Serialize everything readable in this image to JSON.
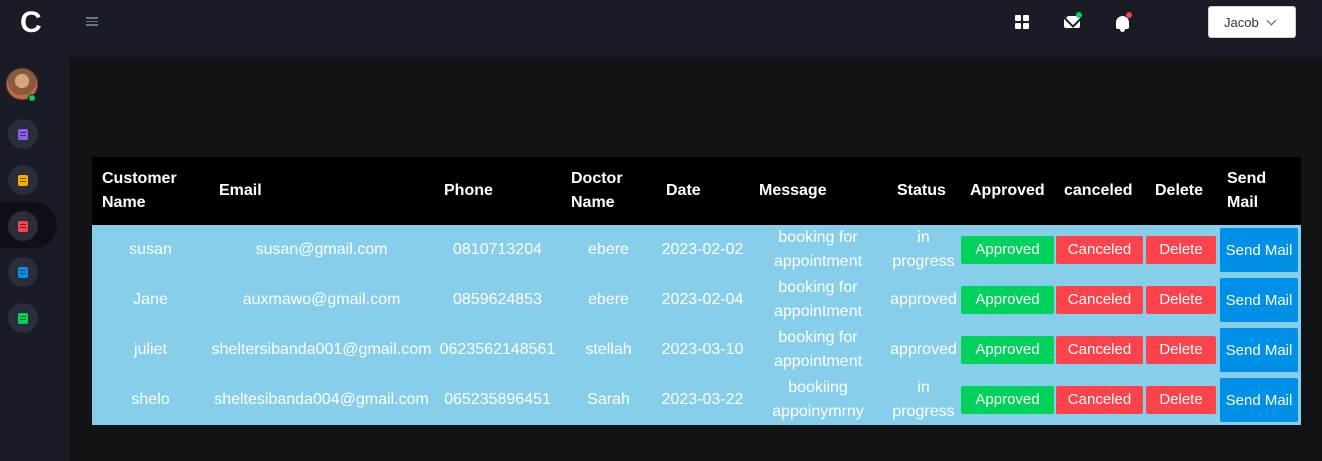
{
  "brand": {
    "logo_letter": "C"
  },
  "sidebar": {
    "items": [
      {
        "icon": "document-icon",
        "color": "#8f5fe8"
      },
      {
        "icon": "document-icon",
        "color": "#ffab00"
      },
      {
        "icon": "document-icon",
        "color": "#fc424a"
      },
      {
        "icon": "document-icon",
        "color": "#0090e7"
      },
      {
        "icon": "document-icon",
        "color": "#00d25b"
      }
    ]
  },
  "topbar": {
    "user_name": "Jacob",
    "mail_badge_color": "#00d25b",
    "bell_badge_color": "#fc424a"
  },
  "table": {
    "headers": [
      "Customer Name",
      "Email",
      "Phone",
      "Doctor Name",
      "Date",
      "Message",
      "Status",
      "Approved",
      "canceled",
      "Delete",
      "Send Mail"
    ],
    "rows": [
      {
        "customer": "susan",
        "email": "susan@gmail.com",
        "phone": "0810713204",
        "doctor": "ebere",
        "date": "2023-02-02",
        "message": "booking for appointment",
        "status": "in progress"
      },
      {
        "customer": "Jane",
        "email": "auxmawo@gmail.com",
        "phone": "0859624853",
        "doctor": "ebere",
        "date": "2023-02-04",
        "message": "booking for appointment",
        "status": "approved"
      },
      {
        "customer": "juliet",
        "email": "sheltersibanda001@gmail.com",
        "phone": "0623562148561",
        "doctor": "stellah",
        "date": "2023-03-10",
        "message": "booking for appointment",
        "status": "approved"
      },
      {
        "customer": "shelo",
        "email": "sheltesibanda004@gmail.com",
        "phone": "065235896451",
        "doctor": "Sarah",
        "date": "2023-03-22",
        "message": "bookiing appoinymrny",
        "status": "in progress"
      }
    ],
    "actions": {
      "approve": "Approved",
      "cancel": "Canceled",
      "delete": "Delete",
      "mail": "Send Mail"
    }
  },
  "colors": {
    "approve": "#00d25b",
    "danger": "#fc424a",
    "primary": "#0090e7",
    "row_bg": "#87ceeb"
  }
}
